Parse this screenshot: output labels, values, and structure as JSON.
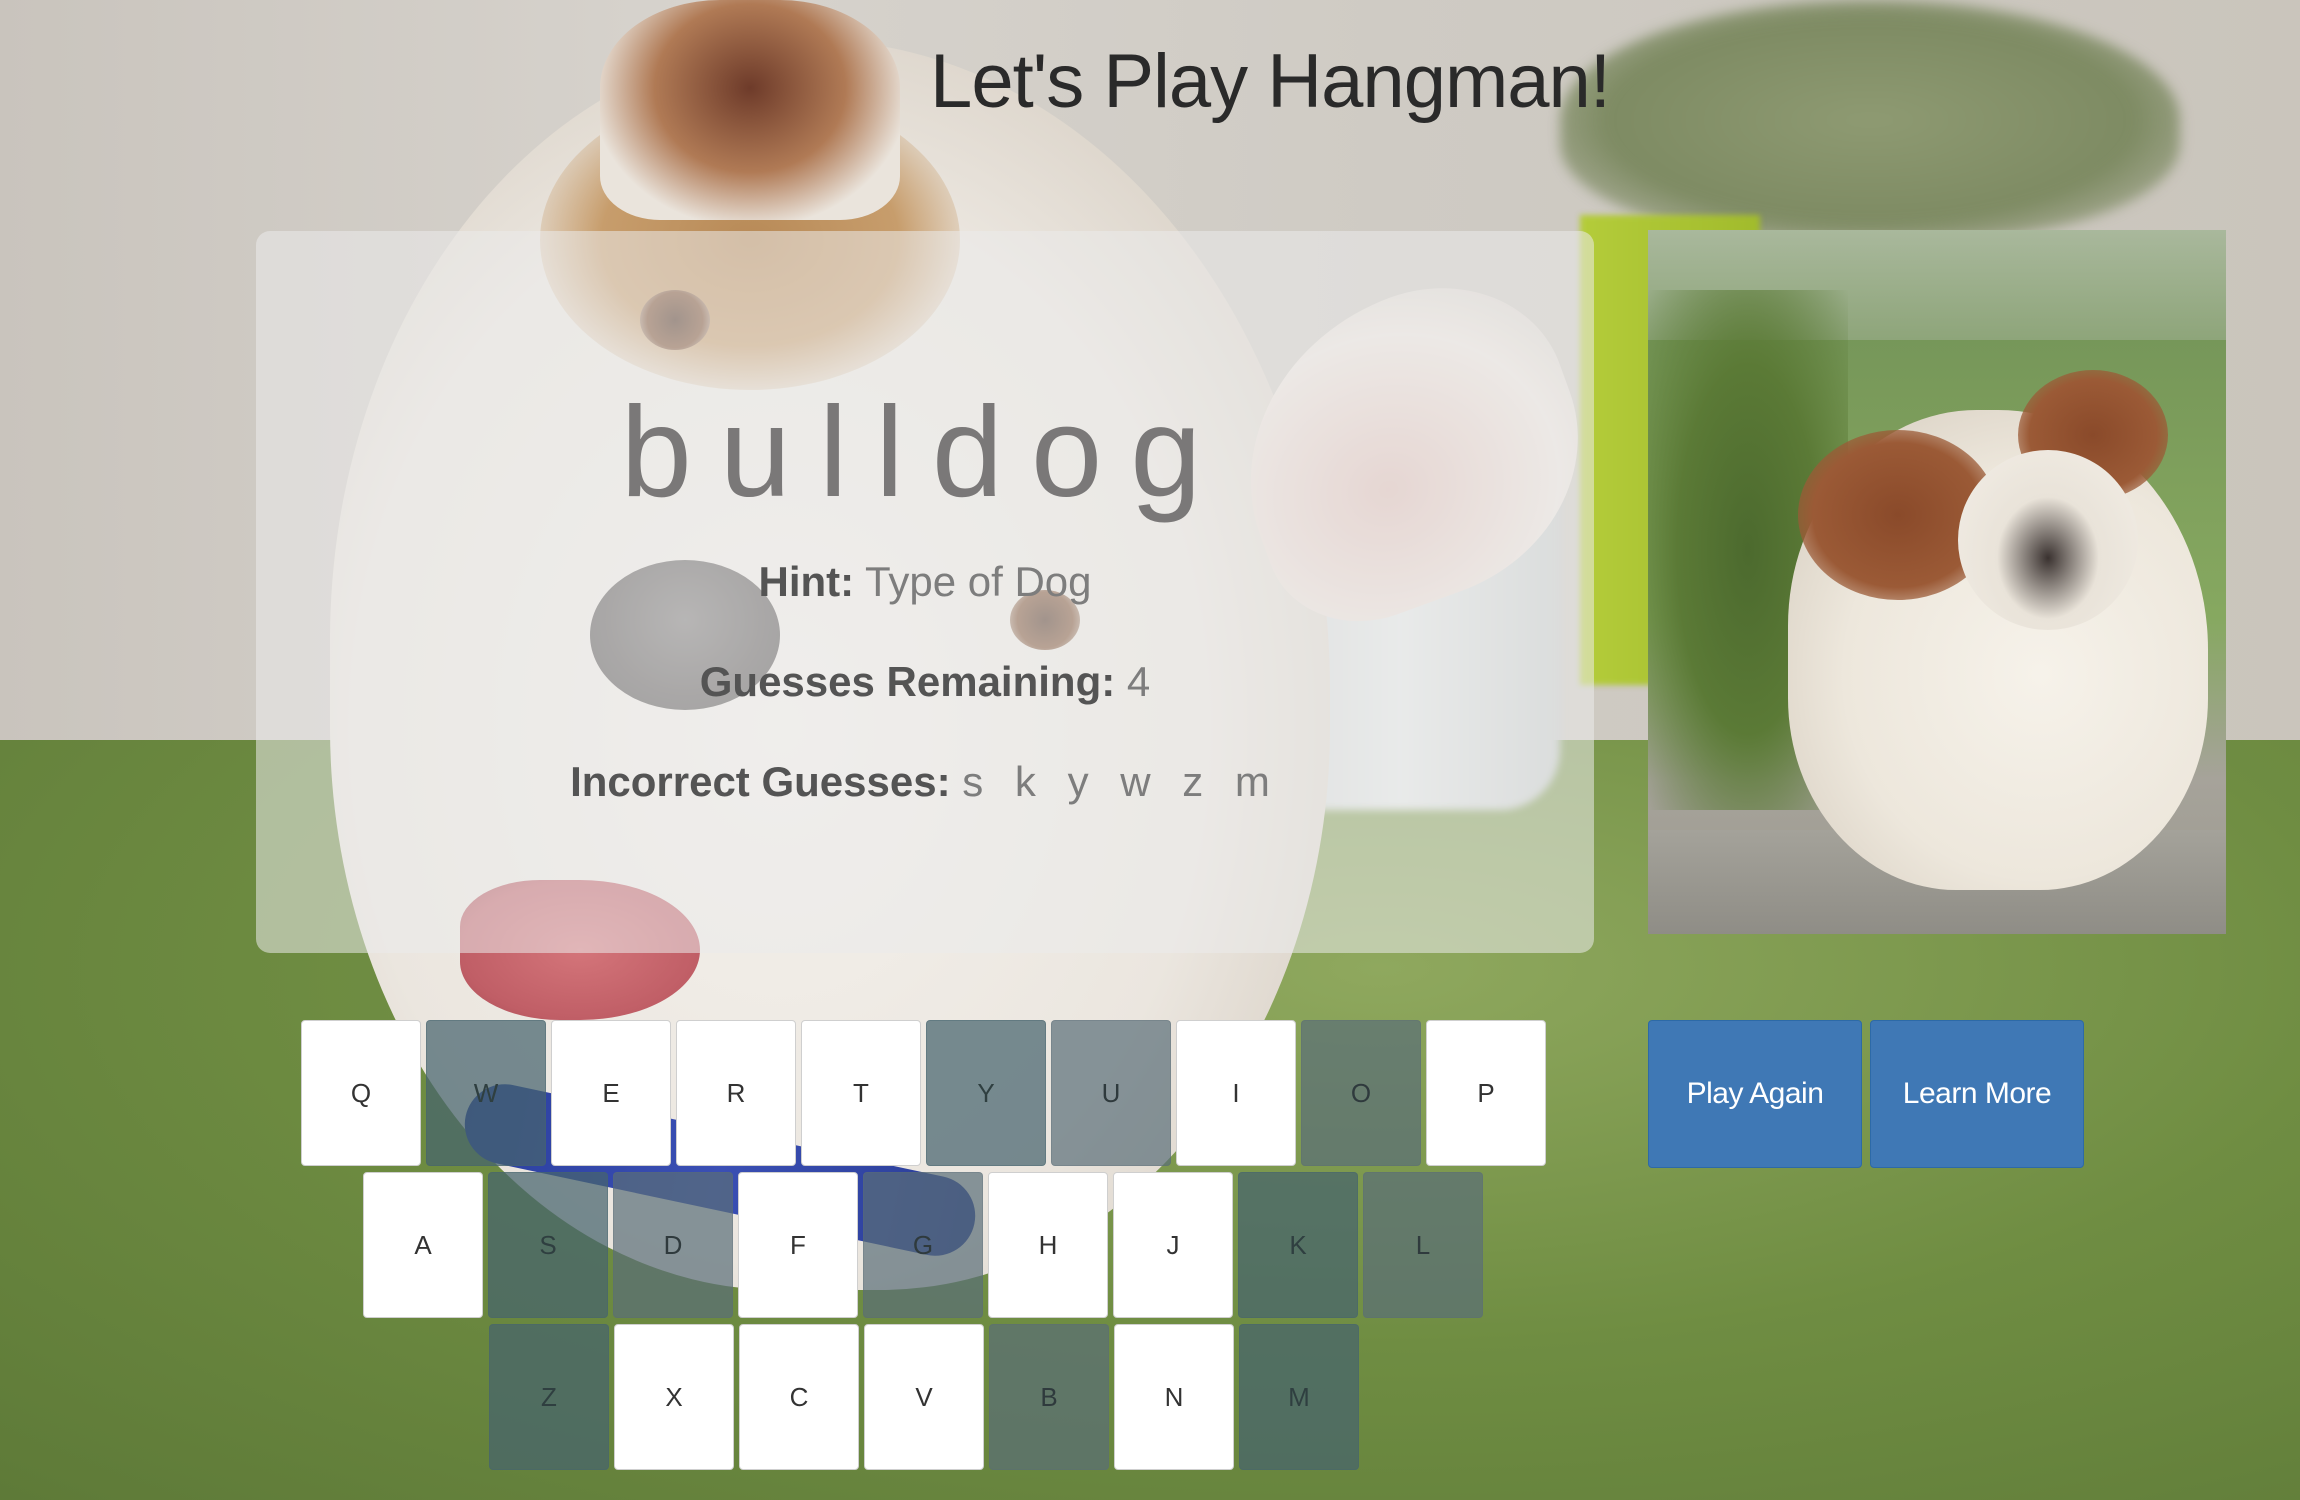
{
  "title": "Let's Play Hangman!",
  "game": {
    "word": "bulldog",
    "hint_label": "Hint:",
    "hint_value": "Type of Dog",
    "remaining_label": "Guesses Remaining:",
    "remaining_value": "4",
    "incorrect_label": "Incorrect Guesses:",
    "incorrect_value": "s k y w z m"
  },
  "keyboard": {
    "row1": [
      {
        "letter": "Q",
        "state": "unused"
      },
      {
        "letter": "W",
        "state": "miss"
      },
      {
        "letter": "E",
        "state": "unused"
      },
      {
        "letter": "R",
        "state": "unused"
      },
      {
        "letter": "T",
        "state": "unused"
      },
      {
        "letter": "Y",
        "state": "miss"
      },
      {
        "letter": "U",
        "state": "hit"
      },
      {
        "letter": "I",
        "state": "unused"
      },
      {
        "letter": "O",
        "state": "hit"
      },
      {
        "letter": "P",
        "state": "unused"
      }
    ],
    "row2": [
      {
        "letter": "A",
        "state": "unused"
      },
      {
        "letter": "S",
        "state": "miss"
      },
      {
        "letter": "D",
        "state": "hit"
      },
      {
        "letter": "F",
        "state": "unused"
      },
      {
        "letter": "G",
        "state": "hit"
      },
      {
        "letter": "H",
        "state": "unused"
      },
      {
        "letter": "J",
        "state": "unused"
      },
      {
        "letter": "K",
        "state": "miss"
      },
      {
        "letter": "L",
        "state": "hit"
      }
    ],
    "row3": [
      {
        "letter": "Z",
        "state": "miss"
      },
      {
        "letter": "X",
        "state": "unused"
      },
      {
        "letter": "C",
        "state": "unused"
      },
      {
        "letter": "V",
        "state": "unused"
      },
      {
        "letter": "B",
        "state": "hit"
      },
      {
        "letter": "N",
        "state": "unused"
      },
      {
        "letter": "M",
        "state": "miss"
      }
    ]
  },
  "buttons": {
    "play_again": "Play Again",
    "learn_more": "Learn More"
  },
  "colors": {
    "button_blue": "#3f78b5",
    "title_text": "#2a2a2a"
  }
}
